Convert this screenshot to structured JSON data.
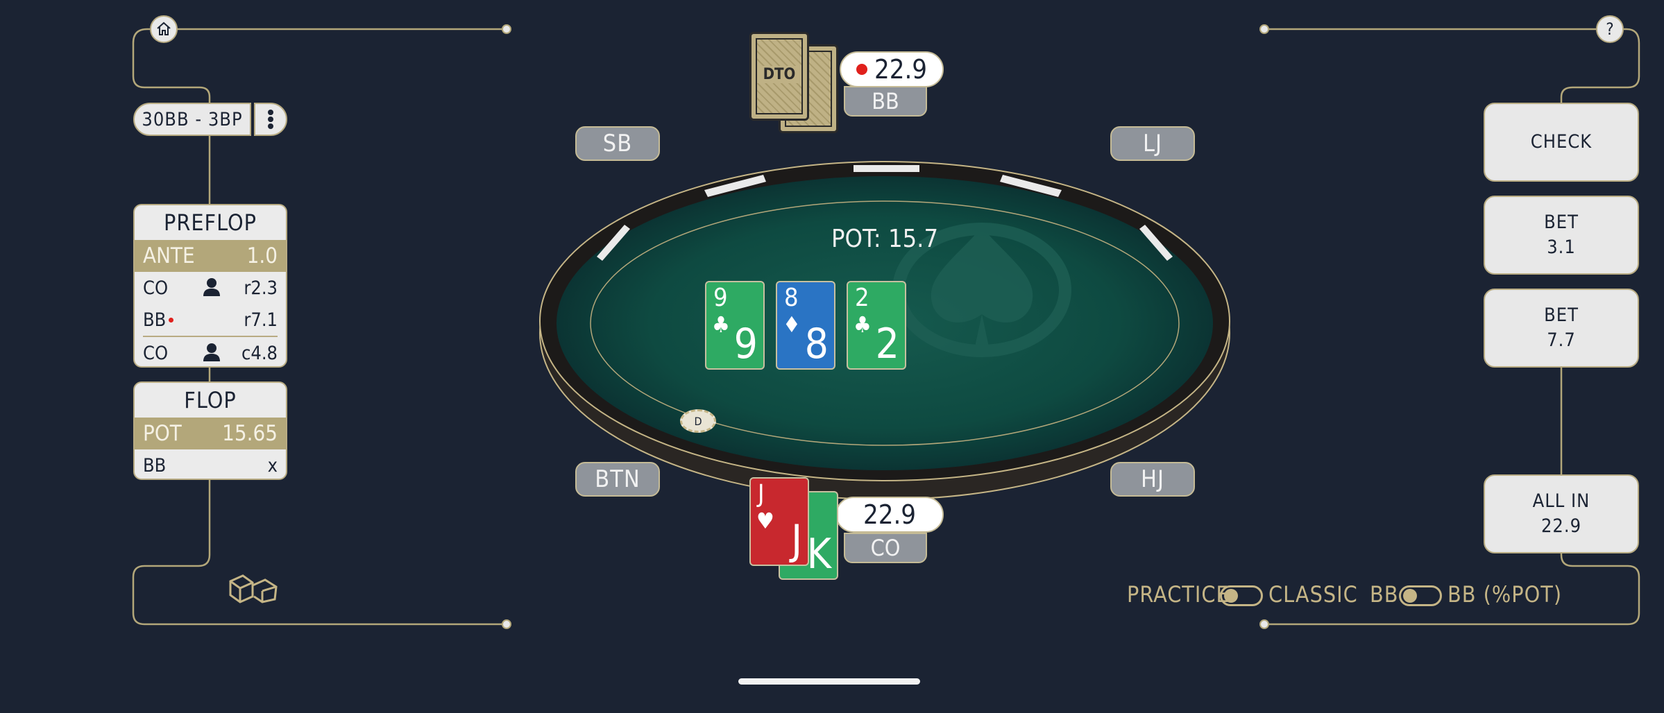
{
  "left_panel": {
    "mode_pill": "30BB - 3BP",
    "preflop": {
      "title": "PREFLOP",
      "ante_label": "ANTE",
      "ante_value": "1.0",
      "rows": [
        {
          "pos": "CO",
          "action": "r2.3"
        },
        {
          "pos": "BB",
          "action": "r7.1"
        },
        {
          "pos": "CO",
          "action": "c4.8"
        }
      ]
    },
    "flop": {
      "title": "FLOP",
      "pot_label": "POT",
      "pot_value": "15.65",
      "rows": [
        {
          "pos": "BB",
          "action": "x"
        }
      ]
    }
  },
  "table": {
    "pot_text": "POT: 15.7",
    "board": [
      {
        "rank": "9",
        "suit": "♣",
        "color": "#2eaa63"
      },
      {
        "rank": "8",
        "suit": "♦",
        "color": "#2a74c4"
      },
      {
        "rank": "2",
        "suit": "♣",
        "color": "#2eaa63"
      }
    ],
    "dealer_chip": "D",
    "seats": {
      "sb": "SB",
      "lj": "LJ",
      "btn": "BTN",
      "hj": "HJ"
    },
    "top_player": {
      "stack": "22.9",
      "position": "BB",
      "card_back_logo": "DTO"
    },
    "bottom_player": {
      "stack": "22.9",
      "position": "CO",
      "cards": [
        {
          "rank": "J",
          "suit": "♥",
          "color": "#c8282e"
        },
        {
          "rank": "K",
          "color": "#2eaa63"
        }
      ]
    }
  },
  "actions": {
    "check": "CHECK",
    "bet1_label": "BET",
    "bet1_value": "3.1",
    "bet2_label": "BET",
    "bet2_value": "7.7",
    "allin_label": "ALL IN",
    "allin_value": "22.9"
  },
  "toggles": {
    "practice": "PRACTICE",
    "classic": "CLASSIC",
    "bb": "BB",
    "bb_pot": "BB (%POT)"
  },
  "icons": {
    "home": "home-icon",
    "help": "?",
    "more": "more-vertical-icon",
    "dice": "dice-icon"
  },
  "colors": {
    "background": "#1b2333",
    "gold": "#c5b586",
    "felt": "#0f4a42"
  }
}
